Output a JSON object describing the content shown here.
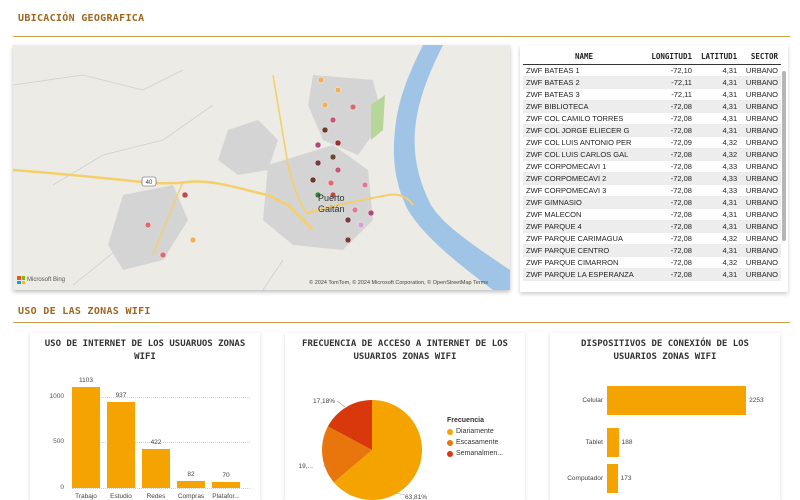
{
  "geo_section": {
    "title": "UBICACIÓN GEOGRAFICA"
  },
  "map": {
    "town_label": "Puerto\nGaitán",
    "road_label": "40",
    "brand": "Microsoft Bing",
    "credit": "© 2024 TomTom, © 2024 Microsoft Corporation, © OpenStreetMap  Terms",
    "colors": {
      "water": "#9fc4e6",
      "road": "#f5cf6a",
      "urban": "#d4d4d4",
      "park": "#b7d79a"
    },
    "markers": [
      {
        "name": "marker-1",
        "color": "#f0b05a"
      },
      {
        "name": "marker-2",
        "color": "#f0b05a"
      },
      {
        "name": "marker-3",
        "color": "#d46a6a"
      },
      {
        "name": "marker-4",
        "color": "#f0b05a"
      },
      {
        "name": "marker-5",
        "color": "#c05a7a"
      },
      {
        "name": "marker-6",
        "color": "#6b3a2c"
      },
      {
        "name": "marker-7",
        "color": "#b04a7a"
      },
      {
        "name": "marker-8",
        "color": "#9b2d2d"
      },
      {
        "name": "marker-9",
        "color": "#6b4a2c"
      },
      {
        "name": "marker-10",
        "color": "#7a3a3a"
      },
      {
        "name": "marker-11",
        "color": "#c05a7a"
      },
      {
        "name": "marker-12",
        "color": "#6b3a2c"
      },
      {
        "name": "marker-13",
        "color": "#e06b6b"
      },
      {
        "name": "marker-14",
        "color": "#3a7a3a"
      },
      {
        "name": "marker-15",
        "color": "#c04a4a"
      },
      {
        "name": "marker-16",
        "color": "#e07a9a"
      },
      {
        "name": "marker-17",
        "color": "#e07a9a"
      },
      {
        "name": "marker-18",
        "color": "#b04a7a"
      },
      {
        "name": "marker-19",
        "color": "#7a3a3a"
      },
      {
        "name": "marker-20",
        "color": "#d4a0d4"
      },
      {
        "name": "marker-21",
        "color": "#7a3a3a"
      },
      {
        "name": "marker-22",
        "color": "#c04a4a"
      }
    ]
  },
  "table": {
    "headers": {
      "name": "NAME",
      "lon": "LONGITUD1",
      "lat": "LATITUD1",
      "sector": "SECTOR"
    },
    "rows": [
      {
        "name": "ZWF BATEAS 1",
        "lon": "-72,10",
        "lat": "4,31",
        "sector": "URBANO"
      },
      {
        "name": "ZWF BATEAS 2",
        "lon": "-72,11",
        "lat": "4,31",
        "sector": "URBANO"
      },
      {
        "name": "ZWF BATEAS 3",
        "lon": "-72,11",
        "lat": "4,31",
        "sector": "URBANO"
      },
      {
        "name": "ZWF BIBLIOTECA",
        "lon": "-72,08",
        "lat": "4,31",
        "sector": "URBANO"
      },
      {
        "name": "ZWF COL CAMILO TORRES",
        "lon": "-72,08",
        "lat": "4,31",
        "sector": "URBANO"
      },
      {
        "name": "ZWF COL JORGE ELIECER G",
        "lon": "-72,08",
        "lat": "4,31",
        "sector": "URBANO"
      },
      {
        "name": "ZWF COL LUIS ANTONIO PER",
        "lon": "-72,09",
        "lat": "4,32",
        "sector": "URBANO"
      },
      {
        "name": "ZWF COL LUIS CARLOS GAL",
        "lon": "-72,08",
        "lat": "4,32",
        "sector": "URBANO"
      },
      {
        "name": "ZWF CORPOMECAVI 1",
        "lon": "-72,08",
        "lat": "4,33",
        "sector": "URBANO"
      },
      {
        "name": "ZWF CORPOMECAVI 2",
        "lon": "-72,08",
        "lat": "4,33",
        "sector": "URBANO"
      },
      {
        "name": "ZWF CORPOMECAVI 3",
        "lon": "-72,08",
        "lat": "4,33",
        "sector": "URBANO"
      },
      {
        "name": "ZWF GIMNASIO",
        "lon": "-72,08",
        "lat": "4,31",
        "sector": "URBANO"
      },
      {
        "name": "ZWF MALECON",
        "lon": "-72,08",
        "lat": "4,31",
        "sector": "URBANO"
      },
      {
        "name": "ZWF PARQUE 4",
        "lon": "-72,08",
        "lat": "4,31",
        "sector": "URBANO"
      },
      {
        "name": "ZWF PARQUE CARIMAGUA",
        "lon": "-72,08",
        "lat": "4,32",
        "sector": "URBANO"
      },
      {
        "name": "ZWF PARQUE CENTRO",
        "lon": "-72,08",
        "lat": "4,31",
        "sector": "URBANO"
      },
      {
        "name": "ZWF PARQUE CIMARRON",
        "lon": "-72,08",
        "lat": "4,32",
        "sector": "URBANO"
      },
      {
        "name": "ZWF PARQUE LA ESPERANZA",
        "lon": "-72,08",
        "lat": "4,31",
        "sector": "URBANO"
      }
    ]
  },
  "wifi_section": {
    "title": "USO DE LAS ZONAS WIFI"
  },
  "colors": {
    "accent": "#c9a24a",
    "bar": "#f4a300"
  },
  "chart_data": [
    {
      "type": "bar",
      "title": "USO DE INTERNET DE LOS USUARUOS ZONAS WIFI",
      "categories": [
        "Trabajo",
        "Estudio",
        "Redes",
        "Compras",
        "Platafor..."
      ],
      "values": [
        1103,
        937,
        422,
        82,
        70
      ],
      "ylim": [
        0,
        1150
      ],
      "yticks": [
        "0",
        "500",
        "1000"
      ],
      "grid": true
    },
    {
      "type": "pie",
      "title": "FRECUENCIA DE ACCESO A INTERNET DE LOS USUARIOS ZONAS WIFI",
      "legend_title": "Frecuencia",
      "legend_placement": "right",
      "slices": [
        {
          "label": "Diariamente",
          "value": 63.81,
          "display": "63,81%",
          "color": "#f4a300"
        },
        {
          "label": "Escasamente",
          "value": 19.01,
          "display": "19,...",
          "color": "#e8760c"
        },
        {
          "label": "Semanalmen...",
          "value": 17.18,
          "display": "17,18%",
          "color": "#d8380c"
        }
      ]
    },
    {
      "type": "bar",
      "orientation": "horizontal",
      "title": "DISPOSITIVOS DE CONEXIÓN DE LOS USUARIOS ZONAS WIFI",
      "categories": [
        "Celular",
        "Tablet",
        "Computador"
      ],
      "values": [
        2253,
        188,
        173
      ],
      "xlim": [
        0,
        2300
      ]
    }
  ]
}
